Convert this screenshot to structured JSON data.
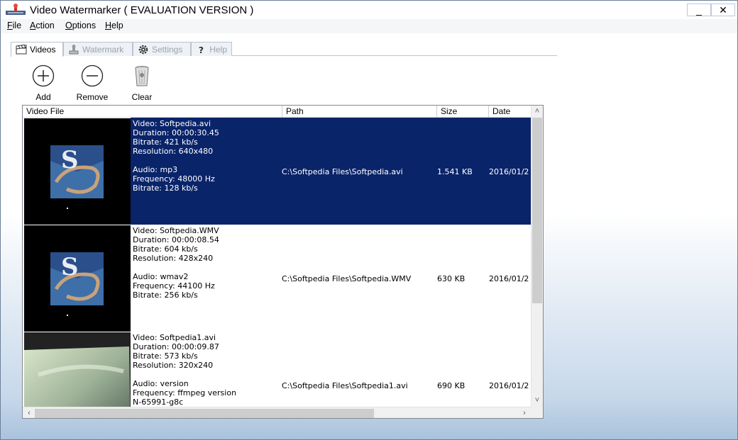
{
  "window": {
    "title": "Video Watermarker ( EVALUATION VERSION )",
    "minimize_glyph": "_",
    "close_glyph": "✕"
  },
  "menu": {
    "file": {
      "key": "F",
      "rest": "ile"
    },
    "action": {
      "key": "A",
      "rest": "ction"
    },
    "options": {
      "key": "O",
      "rest": "ptions"
    },
    "help": {
      "key": "H",
      "rest": "elp"
    }
  },
  "tabs": [
    {
      "label": "Videos",
      "icon": "clapperboard-icon"
    },
    {
      "label": "Watermark",
      "icon": "stamp-icon"
    },
    {
      "label": "Settings",
      "icon": "gear-icon"
    },
    {
      "label": "Help",
      "icon": "question-icon"
    }
  ],
  "toolbar": {
    "add": "Add",
    "remove": "Remove",
    "clear": "Clear"
  },
  "list": {
    "columns": [
      "Video File",
      "Path",
      "Size",
      "Date"
    ],
    "rows": [
      {
        "info": "Video: Softpedia.avi\nDuration: 00:00:30.45\nBitrate: 421 kb/s\nResolution: 640x480\n\nAudio: mp3\nFrequency: 48000 Hz\nBitrate: 128 kb/s",
        "path": "C:\\Softpedia Files\\Softpedia.avi",
        "size": "1.541 KB",
        "date": "2016/01/2",
        "selected": true
      },
      {
        "info": "Video: Softpedia.WMV\nDuration: 00:00:08.54\nBitrate: 604 kb/s\nResolution: 428x240\n\nAudio: wmav2\nFrequency: 44100 Hz\nBitrate: 256 kb/s",
        "path": "C:\\Softpedia Files\\Softpedia.WMV",
        "size": "630 KB",
        "date": "2016/01/2",
        "selected": false
      },
      {
        "info": "Video: Softpedia1.avi\nDuration: 00:00:09.87\nBitrate: 573 kb/s\nResolution: 320x240\n\nAudio: version\nFrequency: ffmpeg version\nN-65991-g8c",
        "path": "C:\\Softpedia Files\\Softpedia1.avi",
        "size": "690 KB",
        "date": "2016/01/2",
        "selected": false
      }
    ]
  },
  "colors": {
    "selection": "#0a246a",
    "thumb_blue": "#3e6fa8"
  }
}
